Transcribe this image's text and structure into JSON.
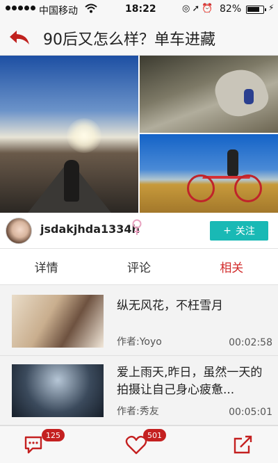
{
  "status_bar": {
    "carrier": "中国移动",
    "time": "18:22",
    "battery_pct": "82%",
    "battery_level": 0.82
  },
  "nav": {
    "title": "90后又怎么样？单车进藏"
  },
  "author": {
    "name": "jsdakjhda1334h",
    "follow_label": "关注",
    "follow_icon": "+"
  },
  "tabs": [
    {
      "label": "详情"
    },
    {
      "label": "评论"
    },
    {
      "label": "相关"
    }
  ],
  "colors": {
    "accent_red": "#d22b2b",
    "follow_teal": "#19b9b5",
    "badge_red": "#c42020"
  },
  "related": [
    {
      "title": "纵无风花，不枉雪月",
      "author": "作者:Yoyo",
      "duration": "00:02:58"
    },
    {
      "title": "爱上雨天,昨日，虽然一天的拍摄让自己身心疲惫...",
      "author": "作者:秀友",
      "duration": "00:05:01"
    }
  ],
  "bottom_bar": {
    "comment_count": "125",
    "like_count": "501"
  }
}
